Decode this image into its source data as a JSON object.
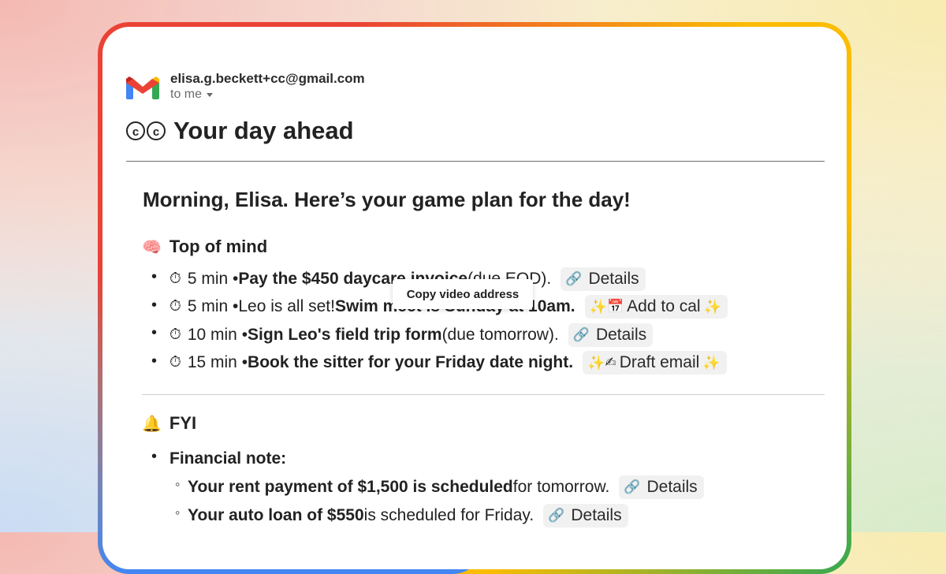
{
  "email": {
    "sender": "elisa.g.beckett+cc@gmail.com",
    "to_line": "to me",
    "subject": "Your day ahead",
    "subject_icon": "cc-icon"
  },
  "greeting": "Morning, Elisa. Here’s your game plan for the day!",
  "top_of_mind": {
    "emoji": "🧠",
    "heading": "Top of mind",
    "items": [
      {
        "time": "5 min •",
        "bold": " Pay the $450 daycare invoice",
        "rest": " (due EOD).",
        "chip": "Details",
        "chip_type": "link"
      },
      {
        "time": "5 min •",
        "lead": " Leo is all set! ",
        "bold": "Swim meet is Sunday at 10am.",
        "rest": "",
        "chip": "Add to cal",
        "chip_type": "calendar"
      },
      {
        "time": "10 min •",
        "bold": " Sign Leo's field trip form",
        "rest": " (due tomorrow).",
        "chip": "Details",
        "chip_type": "link"
      },
      {
        "time": "15 min •",
        "bold": " Book the sitter for your Friday date night.",
        "rest": "",
        "chip": "Draft email",
        "chip_type": "draft"
      }
    ]
  },
  "fyi": {
    "emoji": "🔔",
    "heading": "FYI",
    "financial_label": "Financial note:",
    "items": [
      {
        "bold": "Your rent payment of $1,500 is scheduled",
        "rest": " for tomorrow.",
        "chip": "Details"
      },
      {
        "bold": "Your auto loan of $550",
        "rest": " is scheduled for Friday.",
        "chip": "Details"
      }
    ]
  },
  "tooltip": "Copy video address",
  "colors": {
    "gmail_red": "#ea4335",
    "gmail_yellow": "#fbbc04",
    "gmail_green": "#34a853",
    "gmail_blue": "#4285f4"
  }
}
